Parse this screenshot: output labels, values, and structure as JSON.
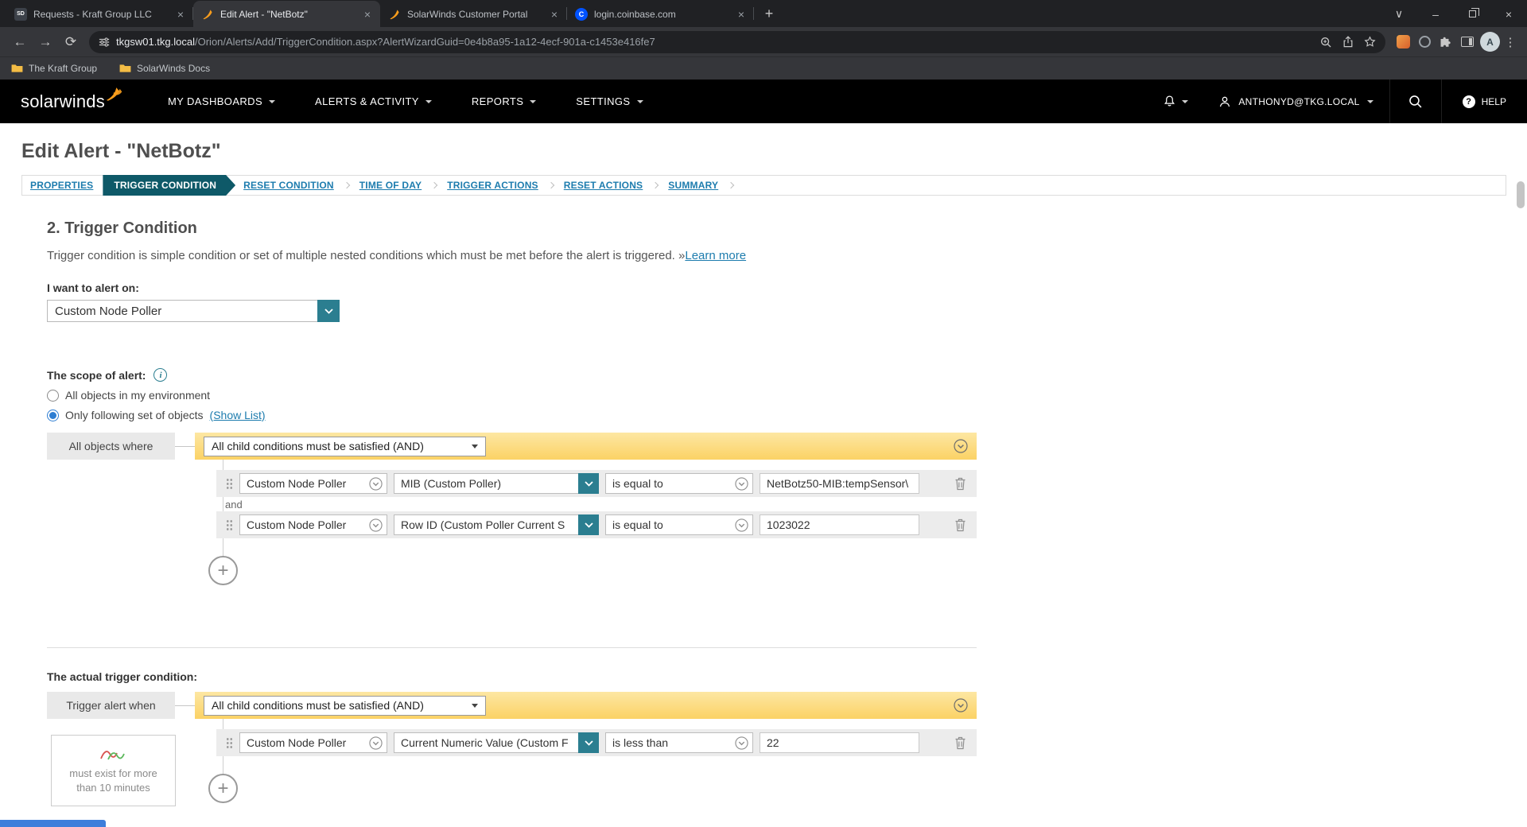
{
  "colors": {
    "brand_orange": "#f99d1c",
    "teal_accent": "#2b7e90",
    "active_step_teal": "#0e5968",
    "logic_bar_yellow": "#fbd265",
    "link_blue": "#1d7cae",
    "radio_selected_blue": "#2d7dd2"
  },
  "browser": {
    "tabs": [
      {
        "title": "Requests - Kraft Group LLC"
      },
      {
        "title": "Edit Alert - \"NetBotz\""
      },
      {
        "title": "SolarWinds Customer Portal"
      },
      {
        "title": "login.coinbase.com"
      }
    ],
    "sd_glyph": "SD",
    "cb_glyph": "C",
    "url_host": "tkgsw01.tkg.local",
    "url_path": "/Orion/Alerts/Add/TriggerCondition.aspx?AlertWizardGuid=0e4b8a95-1a12-4ecf-901a-c1453e416fe7",
    "avatar_letter": "A",
    "bookmarks": [
      {
        "label": "The Kraft Group"
      },
      {
        "label": "SolarWinds Docs"
      }
    ]
  },
  "nav": {
    "logo_text": "solarwinds",
    "items": [
      {
        "label": "MY DASHBOARDS"
      },
      {
        "label": "ALERTS & ACTIVITY"
      },
      {
        "label": "REPORTS"
      },
      {
        "label": "SETTINGS"
      }
    ],
    "user": "ANTHONYD@TKG.LOCAL",
    "help_q": "?",
    "help_label": "HELP"
  },
  "page": {
    "title": "Edit Alert - \"NetBotz\"",
    "wizard": [
      {
        "label": "PROPERTIES"
      },
      {
        "label": "TRIGGER CONDITION"
      },
      {
        "label": "RESET CONDITION"
      },
      {
        "label": "TIME OF DAY"
      },
      {
        "label": "TRIGGER ACTIONS"
      },
      {
        "label": "RESET ACTIONS"
      },
      {
        "label": "SUMMARY"
      }
    ],
    "section_heading": "2. Trigger Condition",
    "description": "Trigger condition is simple condition or set of multiple nested conditions which must be met before the alert is triggered. »",
    "learn_more": "Learn more",
    "alert_on_label": "I want to alert on:",
    "alert_on_value": "Custom Node Poller",
    "scope": {
      "label": "The scope of alert:",
      "radio_all": "All objects in my environment",
      "radio_subset": "Only following set of objects",
      "show_list": "(Show List)",
      "group_label": "All objects where",
      "logic": "All child conditions must be satisfied (AND)",
      "join": "and",
      "rows": [
        {
          "object": "Custom Node Poller",
          "field": "MIB (Custom Poller)",
          "operator": "is equal to",
          "value": "NetBotz50-MIB:tempSensor\\"
        },
        {
          "object": "Custom Node Poller",
          "field": "Row ID (Custom Poller Current S",
          "operator": "is equal to",
          "value": "1023022"
        }
      ]
    },
    "trigger": {
      "label": "The actual trigger condition:",
      "group_label": "Trigger alert when",
      "logic": "All child conditions must be satisfied (AND)",
      "sustain": "must exist for more than 10 minutes",
      "rows": [
        {
          "object": "Custom Node Poller",
          "field": "Current Numeric Value (Custom F",
          "operator": "is less than",
          "value": "22"
        }
      ]
    }
  }
}
